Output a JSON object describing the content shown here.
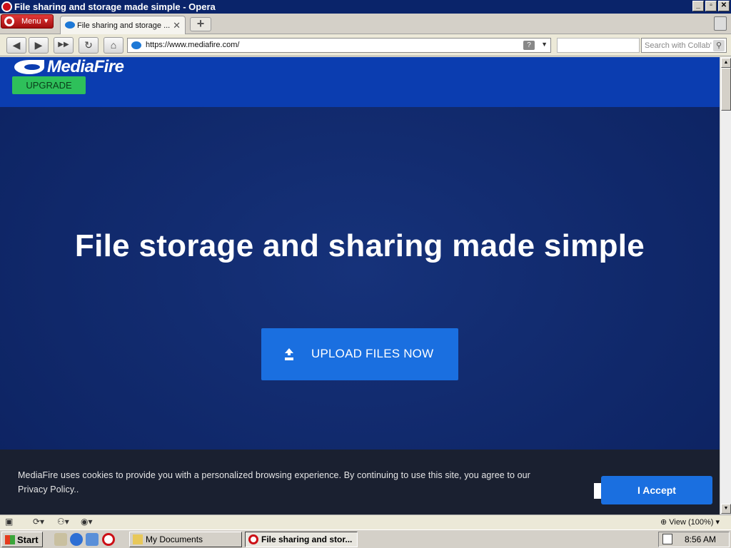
{
  "window": {
    "title": "File sharing and storage made simple - Opera",
    "controls": [
      "_",
      "▫",
      "✕"
    ]
  },
  "tabbar": {
    "menu_label": "Menu",
    "tabs": [
      {
        "label": "File sharing and storage ..."
      }
    ],
    "new_tab": "+"
  },
  "navbar": {
    "url": "https://www.mediafire.com/",
    "search_placeholder": "Search with Collab'",
    "back": "◀",
    "forward": "▶",
    "fast_forward": "▶▶",
    "reload": "↻",
    "home": "⌂",
    "question": "?"
  },
  "site": {
    "logo_text": "MediaFire",
    "upgrade_label": "UPGRADE",
    "hero_title": "File storage and sharing made simple",
    "upload_label": "UPLOAD FILES NOW",
    "cookie_message": "MediaFire uses cookies to provide you with a personalized browsing experience. By continuing to use this site, you agree to our Privacy Policy..",
    "accept_label": "I Accept"
  },
  "statusbar": {
    "zoom": "View (100%)"
  },
  "taskbar": {
    "start_label": "Start",
    "tasks": [
      {
        "label": "My Documents"
      },
      {
        "label": "File sharing and stor..."
      }
    ],
    "clock": "8:56 AM"
  },
  "colors": {
    "site_header": "#0b3db0",
    "hero_bg": "#10286a",
    "upload_button": "#1a6fe0",
    "upgrade_button": "#2ec05a",
    "cookie_bar": "#1a2030"
  }
}
